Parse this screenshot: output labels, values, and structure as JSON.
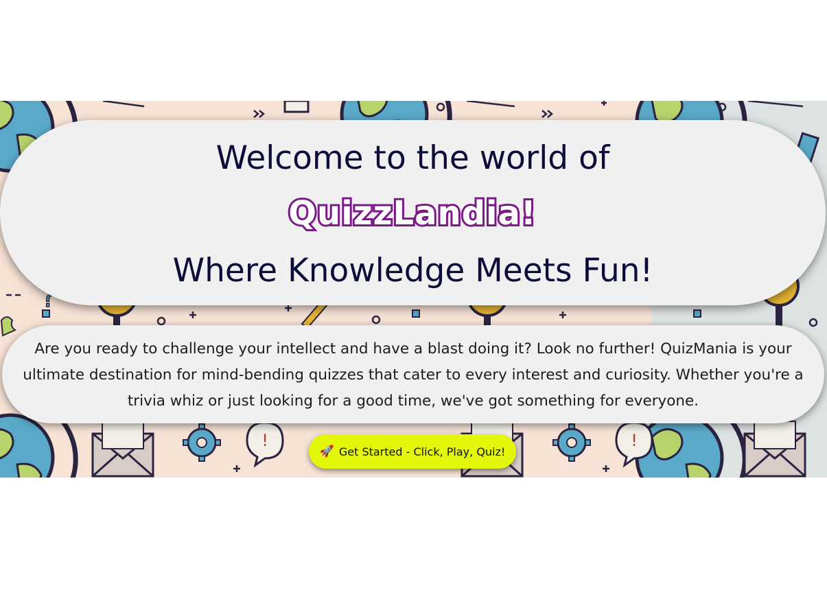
{
  "hero": {
    "welcome_text": "Welcome to the world of",
    "brand_name": "QuizzLandia!",
    "tagline": "Where Knowledge Meets Fun!",
    "intro_text": "Are you ready to challenge your intellect and have a blast doing it? Look no further! QuizMania is your ultimate destination for mind-bending quizzes that cater to every interest and curiosity. Whether you're a trivia whiz or just looking for a good time, we've got something for everyone.",
    "cta": {
      "icon": "rocket-icon",
      "label": "Get Started - Click, Play, Quiz!"
    }
  },
  "colors": {
    "page_background": "#ffffff",
    "hero_background": "#f7e3d6",
    "card_background": "#f0f0f0",
    "heading_text": "#0d0d3a",
    "brand_fill": "#ffffff",
    "brand_outline": "#7a1a86",
    "cta_background": "#e2f70a"
  }
}
